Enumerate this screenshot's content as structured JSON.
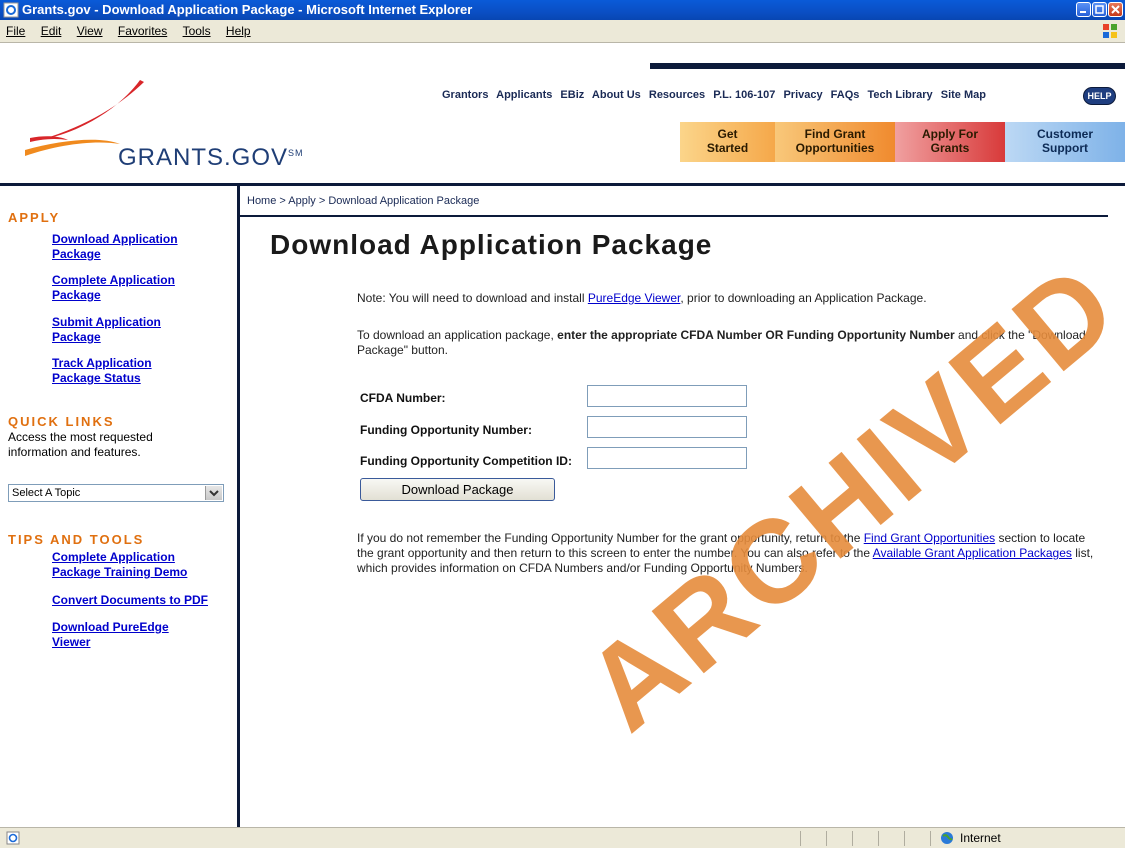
{
  "window": {
    "title": "Grants.gov - Download Application Package - Microsoft Internet Explorer"
  },
  "menu": [
    "File",
    "Edit",
    "View",
    "Favorites",
    "Tools",
    "Help"
  ],
  "header": {
    "logo_text": "GRANTS.GOV",
    "logo_mark": "SM",
    "topnav": [
      "Grantors",
      "Applicants",
      "EBiz",
      "About Us",
      "Resources",
      "P.L. 106-107",
      "Privacy",
      "FAQs",
      "Tech Library",
      "Site Map"
    ],
    "help_label": "HELP",
    "tabs": [
      {
        "line1": "Get",
        "line2": "Started"
      },
      {
        "line1": "Find Grant",
        "line2": "Opportunities"
      },
      {
        "line1": "Apply For",
        "line2": "Grants"
      },
      {
        "line1": "Customer",
        "line2": "Support"
      }
    ]
  },
  "sidebar": {
    "apply_heading": "APPLY",
    "apply_links": [
      {
        "line1": "Download Application",
        "line2": "Package"
      },
      {
        "line1": "Complete Application",
        "line2": "Package"
      },
      {
        "line1": "Submit Application",
        "line2": "Package"
      },
      {
        "line1": "Track Application",
        "line2": "Package Status"
      }
    ],
    "quick_heading": "QUICK LINKS",
    "quick_text_1": "Access the most requested",
    "quick_text_2": "information and features.",
    "topic_select": "Select A Topic",
    "tips_heading": "TIPS AND TOOLS",
    "tips_links": [
      {
        "line1": "Complete Application",
        "line2": "Package Training Demo"
      },
      {
        "line1": "Convert Documents to PDF",
        "line2": ""
      },
      {
        "line1": "Download PureEdge",
        "line2": "Viewer"
      }
    ]
  },
  "main": {
    "breadcrumb": "Home > Apply > Download Application Package",
    "title": "Download Application Package",
    "note_prefix": "Note: You will need to download and install ",
    "note_link": "PureEdge Viewer",
    "note_suffix": ", prior to downloading an Application Package.",
    "instr_prefix": "To download an application package, ",
    "instr_bold": "enter the appropriate CFDA Number OR Funding Opportunity Number",
    "instr_suffix": " and click the \"Download Package\" button.",
    "fields": [
      {
        "label": "CFDA Number:",
        "value": ""
      },
      {
        "label": "Funding Opportunity Number:",
        "value": ""
      },
      {
        "label": "Funding Opportunity Competition ID:",
        "value": ""
      }
    ],
    "download_button": "Download Package",
    "help_p1": "If you do not remember the Funding Opportunity Number for the grant opportunity, return to the ",
    "help_link1": "Find Grant Opportunities",
    "help_p2": " section to locate the grant opportunity and then return to this screen to enter the number. You can also refer to the ",
    "help_link2": "Available Grant Application Packages",
    "help_p3": " list, which provides information on CFDA Numbers and/or Funding Opportunity Numbers."
  },
  "watermark": "ARCHIVED",
  "statusbar": {
    "zone": "Internet"
  },
  "colors": {
    "navy": "#0c1a3a",
    "orange_heading": "#e07010",
    "link": "#0000cc"
  }
}
